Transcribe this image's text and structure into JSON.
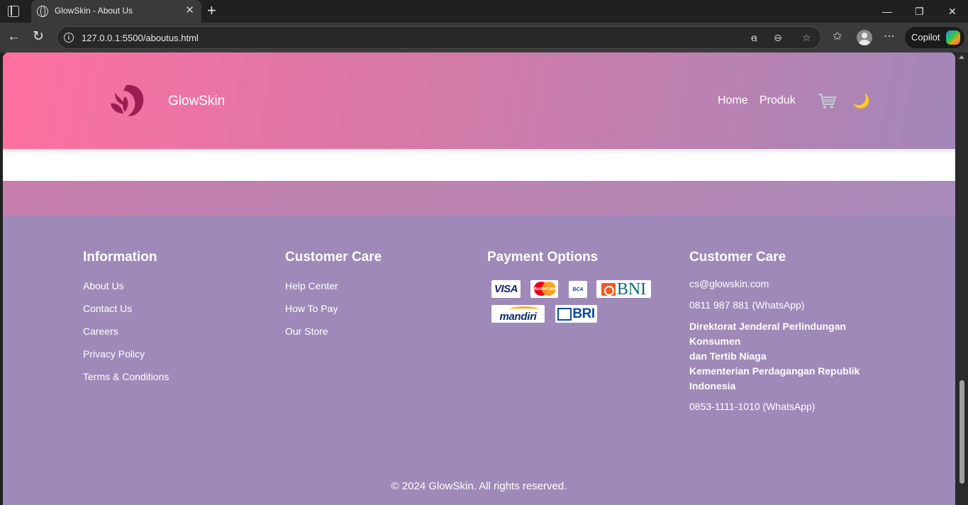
{
  "browser": {
    "tab_title": "GlowSkin - About Us",
    "url": "127.0.0.1:5500/aboutus.html",
    "copilot_label": "Copilot",
    "icons": [
      "tab-actions-icon",
      "globe-icon",
      "close-icon",
      "plus-icon",
      "minimize-icon",
      "restore-icon",
      "close-window-icon",
      "back-icon",
      "refresh-icon",
      "info-icon",
      "read-aloud-icon",
      "more-icon",
      "favorite-star-icon",
      "favorites-icon",
      "profile-icon",
      "settings-more-icon"
    ]
  },
  "header": {
    "brand": "GlowSkin",
    "nav": [
      "Home",
      "Produk"
    ],
    "colors": {
      "gradient_start": "#fe6fa0",
      "gradient_end": "#a287b8"
    }
  },
  "footer": {
    "information": {
      "title": "Information",
      "links": [
        "About Us",
        "Contact Us",
        "Careers",
        "Privacy Policy",
        "Terms & Conditions"
      ]
    },
    "customer_care": {
      "title": "Customer Care",
      "links": [
        "Help Center",
        "How To Pay",
        "Our Store"
      ]
    },
    "payment": {
      "title": "Payment Options",
      "methods": [
        "VISA",
        "MasterCard",
        "BCA",
        "BNI",
        "mandiri",
        "BRI"
      ]
    },
    "contact": {
      "title": "Customer Care",
      "email": "cs@glowskin.com",
      "phone": "0811 987 881 (WhatsApp)",
      "agency_line1": "Direktorat Jenderal Perlindungan Konsumen",
      "agency_line2": "dan Tertib Niaga",
      "agency_line3": "Kementerian Perdagangan Republik Indonesia",
      "agency_phone": "0853-1111-1010 (WhatsApp)"
    },
    "copyright": "© 2024 GlowSkin. All rights reserved.",
    "background": "#9e89b8"
  }
}
